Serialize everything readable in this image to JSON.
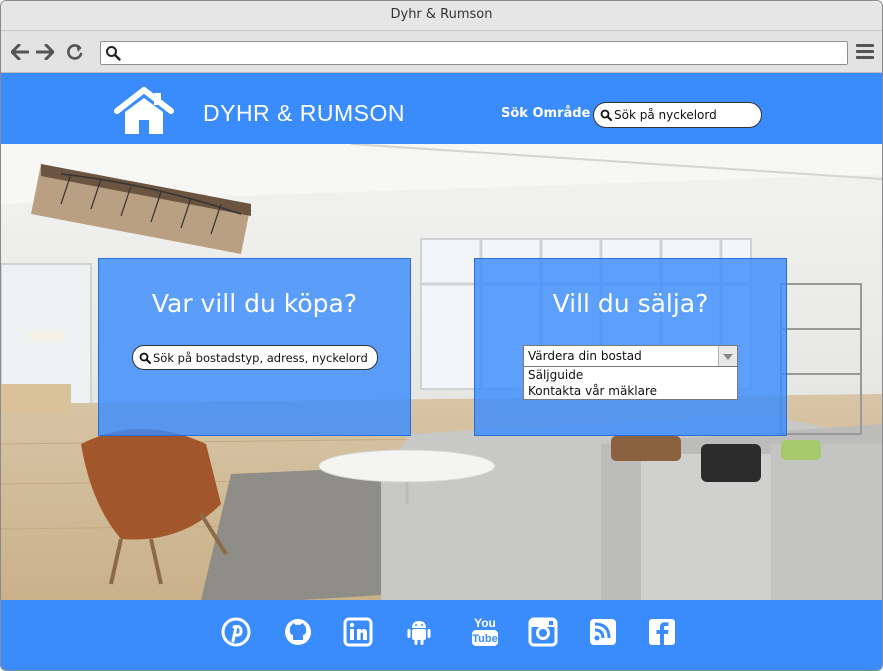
{
  "window": {
    "title": "Dyhr & Rumson"
  },
  "browser": {
    "back_icon": "arrow-left-icon",
    "forward_icon": "arrow-right-icon",
    "reload_icon": "reload-icon",
    "url": "",
    "menu_icon": "hamburger-menu-icon"
  },
  "header": {
    "logo_icon": "home-icon",
    "brand": "DYHR & RUMSON",
    "search_area_label": "Sök Område",
    "search_placeholder": "Sök på nyckelord"
  },
  "buy": {
    "title": "Var vill du köpa?",
    "search_placeholder": "Sök på bostadstyp, adress, nyckelord"
  },
  "sell": {
    "title": "Vill du sälja?",
    "select_value": "Värdera din bostad",
    "options": [
      "Säljguide",
      "Kontakta vår mäklare"
    ]
  },
  "footer": {
    "social_icons": [
      "pinterest-icon",
      "github-icon",
      "linkedin-icon",
      "android-icon",
      "youtube-icon",
      "instagram-icon",
      "rss-icon",
      "facebook-icon"
    ]
  },
  "colors": {
    "primary": "#3a8cfc",
    "panel": "#3a8cfc",
    "toolbar": "#e3e3e3"
  }
}
